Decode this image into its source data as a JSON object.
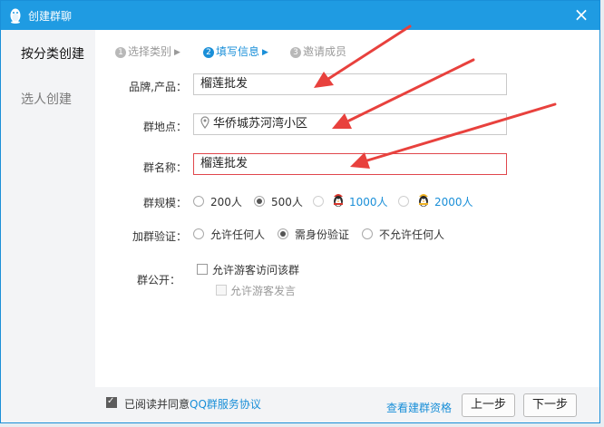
{
  "window": {
    "title": "创建群聊",
    "close_glyph": "×"
  },
  "nav": {
    "items": [
      {
        "label": "按分类创建"
      },
      {
        "label": "选人创建"
      }
    ]
  },
  "steps": [
    {
      "num": "1",
      "label": "选择类别"
    },
    {
      "num": "2",
      "label": "填写信息"
    },
    {
      "num": "3",
      "label": "邀请成员"
    }
  ],
  "form": {
    "brand_label": "品牌,产品：",
    "brand_value": "榴莲批发",
    "location_label": "群地点：",
    "location_value": "华侨城苏河湾小区",
    "name_label": "群名称：",
    "name_value": "榴莲批发",
    "scale_label": "群规模：",
    "scale_options": [
      "200人",
      "500人",
      "1000人",
      "2000人"
    ],
    "scale_selected": "500人",
    "verify_label": "加群验证：",
    "verify_options": [
      "允许任何人",
      "需身份验证",
      "不允许任何人"
    ],
    "verify_selected": "需身份验证",
    "public_label": "群公开：",
    "public_option_1": "允许游客访问该群",
    "public_option_2": "允许游客发言"
  },
  "footer": {
    "agree_text": "已阅读并同意",
    "agreement_link": "QQ群服务协议",
    "qualification_link": "查看建群资格",
    "prev_button": "上一步",
    "next_button": "下一步"
  },
  "colors": {
    "titlebar": "#1f9be2",
    "accent": "#1a8fd8",
    "error_border": "#e0474c",
    "arrow": "#e8413d"
  },
  "icons": [
    "qq-penguin-icon",
    "close-icon",
    "location-pin-icon",
    "penguin-red-icon",
    "penguin-yellow-icon"
  ]
}
